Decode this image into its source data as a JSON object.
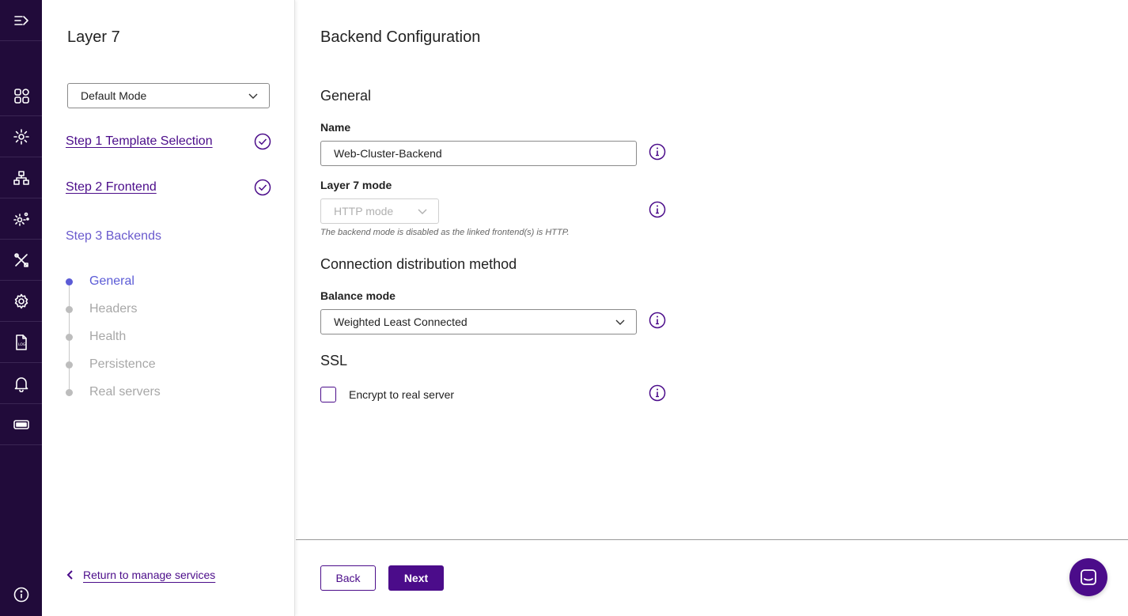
{
  "colors": {
    "rail_bg": "#210b3a",
    "brand": "#4b0c8a",
    "active_step": "#5b5bd6"
  },
  "rail": {
    "items": [
      {
        "icon": "menu-expand-icon"
      },
      {
        "icon": "dashboard-grid-icon"
      },
      {
        "icon": "services-gear-icon"
      },
      {
        "icon": "network-cluster-icon"
      },
      {
        "icon": "cluster-settings-icon"
      },
      {
        "icon": "tools-icon"
      },
      {
        "icon": "settings-gear-icon"
      },
      {
        "icon": "log-file-icon"
      },
      {
        "icon": "notification-bell-icon"
      },
      {
        "icon": "license-ticket-icon"
      }
    ],
    "bottom_icon": "info-icon"
  },
  "wizard": {
    "title": "Layer 7",
    "mode": "Default Mode",
    "steps": [
      {
        "label": "Step 1 Template Selection",
        "status": "complete"
      },
      {
        "label": "Step 2 Frontend",
        "status": "complete"
      },
      {
        "label": "Step 3 Backends",
        "status": "current"
      }
    ],
    "substeps": [
      {
        "label": "General",
        "active": true
      },
      {
        "label": "Headers",
        "active": false
      },
      {
        "label": "Health",
        "active": false
      },
      {
        "label": "Persistence",
        "active": false
      },
      {
        "label": "Real servers",
        "active": false
      }
    ],
    "return_label": "Return to manage services"
  },
  "main": {
    "title": "Backend Configuration",
    "general": {
      "heading": "General",
      "name_label": "Name",
      "name_value": "Web-Cluster-Backend",
      "mode_label": "Layer 7 mode",
      "mode_value": "HTTP mode",
      "mode_hint": "The backend mode is disabled as the linked frontend(s) is HTTP."
    },
    "distribution": {
      "heading": "Connection distribution method",
      "balance_label": "Balance mode",
      "balance_value": "Weighted Least Connected"
    },
    "ssl": {
      "heading": "SSL",
      "encrypt_label": "Encrypt to real server",
      "encrypt_checked": false
    },
    "footer": {
      "back_label": "Back",
      "next_label": "Next"
    }
  }
}
